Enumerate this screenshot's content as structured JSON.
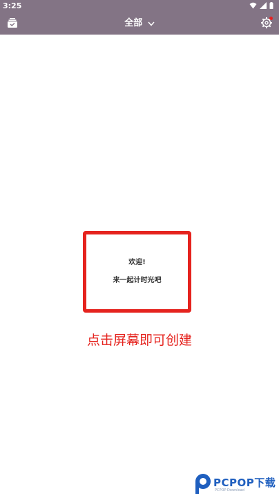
{
  "status_bar": {
    "time": "3:25"
  },
  "header": {
    "title": "全部",
    "left_icon": "inbox-archive-icon",
    "right_icon": "gear-icon",
    "notify_color": "#e52222"
  },
  "welcome_card": {
    "line1": "欢迎!",
    "line2": "来一起计时光吧"
  },
  "hint": "点击屏幕即可创建",
  "watermark": {
    "brand": "PCPOP下载",
    "subtitle": "PCPOP Download"
  },
  "colors": {
    "header": "#837485",
    "accent_red": "#e5231e",
    "watermark_blue": "#1f5fbf"
  }
}
